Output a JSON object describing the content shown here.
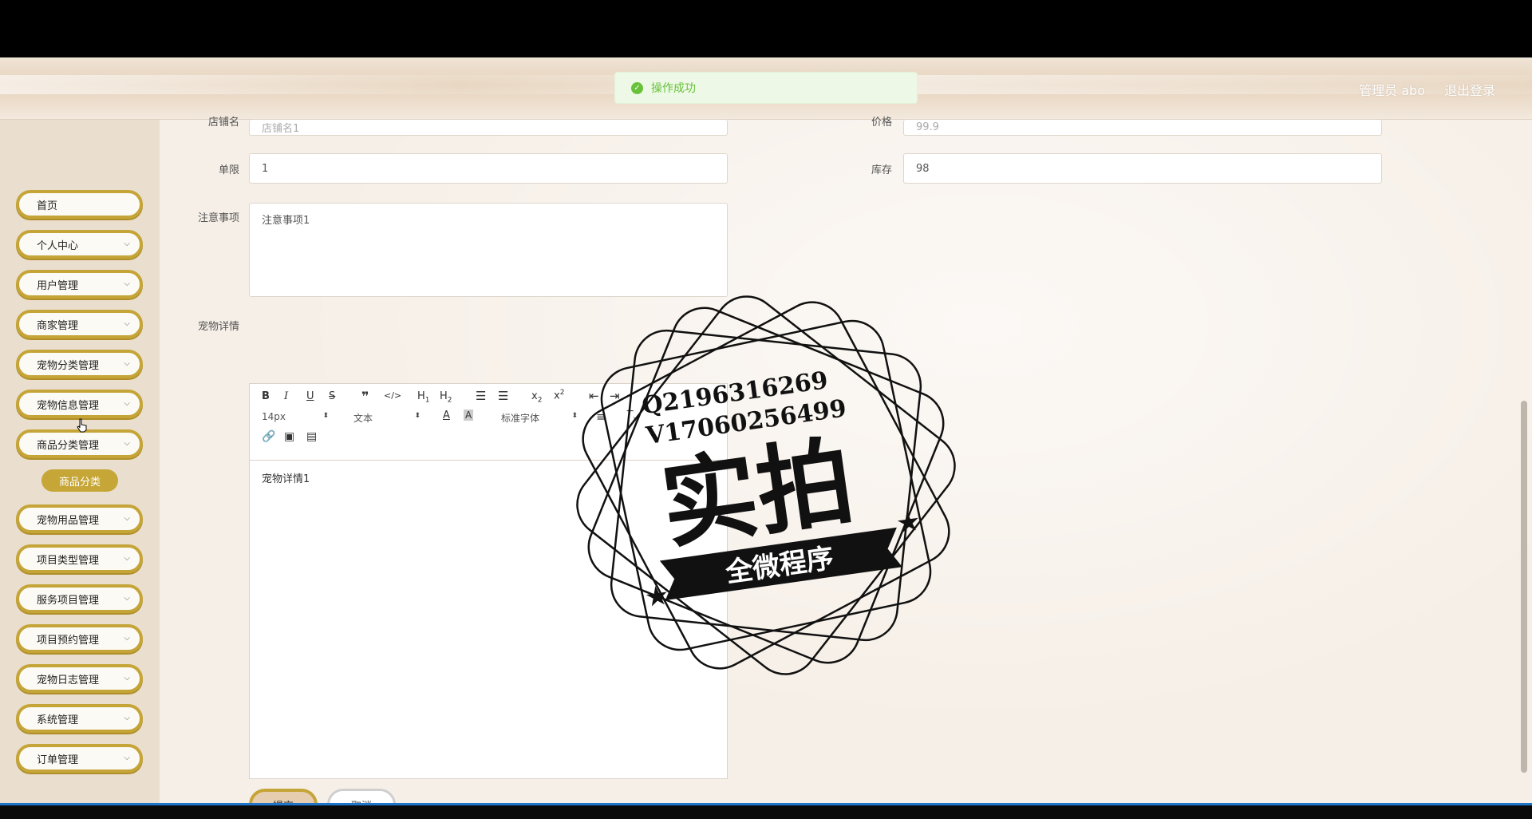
{
  "toast": {
    "message": "操作成功"
  },
  "header": {
    "user": "管理员 abo",
    "logout": "退出登录"
  },
  "sidebar": {
    "items": [
      {
        "label": "首页"
      },
      {
        "label": "个人中心"
      },
      {
        "label": "用户管理"
      },
      {
        "label": "商家管理"
      },
      {
        "label": "宠物分类管理"
      },
      {
        "label": "宠物信息管理"
      },
      {
        "label": "商品分类管理"
      },
      {
        "label": "宠物用品管理"
      },
      {
        "label": "项目类型管理"
      },
      {
        "label": "服务项目管理"
      },
      {
        "label": "项目预约管理"
      },
      {
        "label": "宠物日志管理"
      },
      {
        "label": "系统管理"
      },
      {
        "label": "订单管理"
      }
    ],
    "submenu": {
      "label": "商品分类"
    }
  },
  "form": {
    "shop_label": "店铺名",
    "shop_value": "店铺名1",
    "price_label": "价格",
    "price_value": "99.9",
    "limit_label": "单限",
    "limit_value": "1",
    "stock_label": "库存",
    "stock_value": "98",
    "notes_label": "注意事项",
    "notes_value": "注意事项1",
    "detail_label": "宠物详情",
    "detail_value": "宠物详情1",
    "submit": "提交",
    "cancel": "取消"
  },
  "editor_toolbar": {
    "font_size": "14px",
    "text_type": "文本",
    "font_family": "标准字体"
  },
  "watermark": {
    "line1": "Q2196316269",
    "line2": "V17060256499",
    "big": "实拍",
    "banner": "全微程序"
  }
}
